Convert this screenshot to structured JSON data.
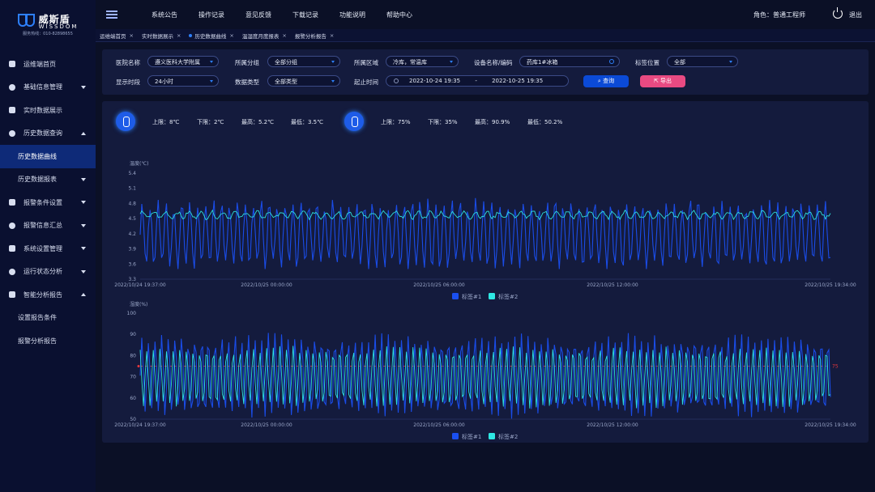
{
  "brand": {
    "name": "威斯盾",
    "name_en": "WISSDOM",
    "hotline": "服务热线：010-82898655"
  },
  "sidebar": {
    "items": [
      {
        "label": "运维端首页",
        "icon": "home-icon"
      },
      {
        "label": "基础信息管理",
        "icon": "database-icon",
        "arrow": "down"
      },
      {
        "label": "实时数据展示",
        "icon": "monitor-icon"
      },
      {
        "label": "历史数据查询",
        "icon": "history-icon",
        "arrow": "up"
      },
      {
        "label": "历史数据曲线",
        "sub": true,
        "active": true
      },
      {
        "label": "历史数据报表",
        "sub": true,
        "arrow": "down"
      },
      {
        "label": "报警条件设置",
        "icon": "bulb-icon",
        "arrow": "down"
      },
      {
        "label": "报警信息汇总",
        "icon": "alarm-icon",
        "arrow": "down"
      },
      {
        "label": "系统设置管理",
        "icon": "gear-icon",
        "arrow": "down"
      },
      {
        "label": "运行状态分析",
        "icon": "analysis-icon",
        "arrow": "down"
      },
      {
        "label": "智能分析报告",
        "icon": "report-icon",
        "arrow": "up"
      },
      {
        "label": "设置报告条件",
        "sub": true
      },
      {
        "label": "报警分析报告",
        "sub": true
      }
    ]
  },
  "topnav": [
    "系统公告",
    "操作记录",
    "意见反馈",
    "下载记录",
    "功能说明",
    "帮助中心"
  ],
  "header": {
    "role": "角色：",
    "role_value": "普通工程师",
    "logout": "退出"
  },
  "tabs": [
    {
      "label": "运维端首页"
    },
    {
      "label": "实时数据展示"
    },
    {
      "label": "历史数据曲线",
      "active": true
    },
    {
      "label": "温湿度月度报表"
    },
    {
      "label": "报警分析报告"
    }
  ],
  "filters": {
    "hospital_label": "医院名称",
    "hospital_value": "遵义医科大学附属",
    "group_label": "所属分组",
    "group_value": "全部分组",
    "area_label": "所属区域",
    "area_value": "冷库，常温库",
    "device_label": "设备名称/编码",
    "device_value": "药库1#冰箱",
    "tag_label": "标签位置",
    "tag_value": "全部",
    "period_label": "显示时段",
    "period_value": "24小时",
    "type_label": "数据类型",
    "type_value": "全部类型",
    "time_label": "起止时间",
    "start": "2022-10-24 19:35",
    "sep": "-",
    "end": "2022-10-25 19:35",
    "query": "查询",
    "export": "导出"
  },
  "stats": {
    "temp": {
      "upper": "上限：8℃",
      "lower": "下限：2℃",
      "max": "最高：5.2℃",
      "min": "最低：3.5℃"
    },
    "hum": {
      "upper": "上限：75%",
      "lower": "下限：35%",
      "max": "最高：90.9%",
      "min": "最低：50.2%"
    }
  },
  "chart_data": [
    {
      "type": "line",
      "ylabel": "温度(℃)",
      "ylim": [
        3.3,
        5.4
      ],
      "yticks": [
        "5.4",
        "5.1",
        "4.8",
        "4.5",
        "4.2",
        "3.9",
        "3.6",
        "3.3"
      ],
      "xticks": [
        "2022/10/24 19:37:00",
        "2022/10/25 00:00:00",
        "2022/10/25 06:00:00",
        "2022/10/25 12:00:00",
        "2022/10/25 19:34:00"
      ],
      "series": [
        {
          "name": "标签#1",
          "color": "#1a4ff0",
          "range": [
            3.5,
            5.2
          ]
        },
        {
          "name": "标签#2",
          "color": "#2ee8e4",
          "range": [
            4.45,
            4.8
          ]
        }
      ],
      "legend": "bottom-center",
      "grid": false
    },
    {
      "type": "line",
      "ylabel": "湿度(%)",
      "ylim": [
        50,
        100
      ],
      "yticks": [
        "100",
        "90",
        "80",
        "70",
        "60",
        "50"
      ],
      "xticks": [
        "2022/10/24 19:37:00",
        "2022/10/25 00:00:00",
        "2022/10/25 06:00:00",
        "2022/10/25 12:00:00",
        "2022/10/25 19:34:00"
      ],
      "series": [
        {
          "name": "标签#1",
          "color": "#1a4ff0",
          "range": [
            50.2,
            90.9
          ]
        },
        {
          "name": "标签#2",
          "color": "#2ee8e4",
          "range": [
            55,
            85
          ]
        }
      ],
      "threshold": {
        "value": 75,
        "label": "75",
        "color": "#e8383d"
      },
      "legend": "bottom-center",
      "grid": false
    }
  ]
}
